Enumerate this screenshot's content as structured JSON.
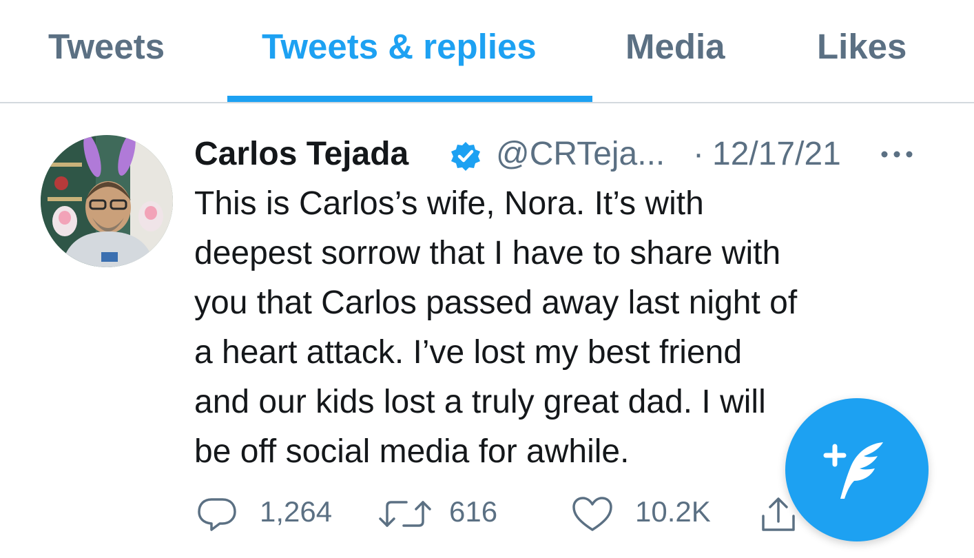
{
  "tabs": [
    {
      "label": "Tweets",
      "active": false
    },
    {
      "label": "Tweets & replies",
      "active": true
    },
    {
      "label": "Media",
      "active": false
    },
    {
      "label": "Likes",
      "active": false
    }
  ],
  "tweet": {
    "author": {
      "display_name": "Carlos Tejada",
      "handle": "@CRTeja...",
      "verified": true
    },
    "separator": "·",
    "timestamp": "12/17/21",
    "body_lines": [
      "This is Carlos’s wife, Nora. It’s with",
      "deepest sorrow that I have to share with",
      "you that Carlos passed away last night of",
      "a heart attack. I’ve lost my best friend",
      "and our kids lost a truly great dad. I will",
      "be off social media for awhile."
    ],
    "actions": {
      "reply_count": "1,264",
      "retweet_count": "616",
      "like_count": "10.2K"
    }
  },
  "icons": {
    "reply": "comment-bubble-icon",
    "retweet": "retweet-arrows-icon",
    "like": "heart-icon",
    "share": "share-upload-icon",
    "more": "more-horizontal-icon",
    "verified": "verified-badge-icon",
    "compose": "compose-feather-plus-icon"
  },
  "colors": {
    "accent": "#1da1f2",
    "text_primary": "#14171a",
    "text_secondary": "#5b7083",
    "divider": "#d3d9de"
  }
}
